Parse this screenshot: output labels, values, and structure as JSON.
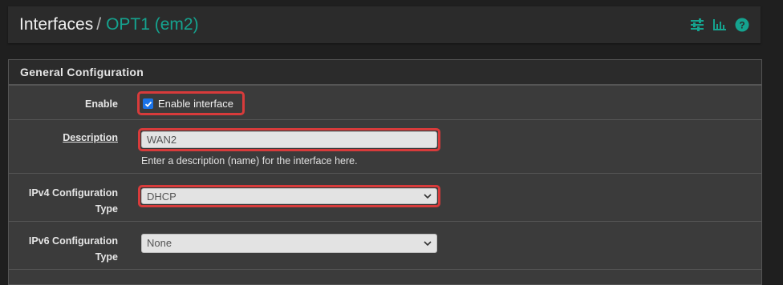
{
  "breadcrumb": {
    "section": "Interfaces",
    "separator": "/",
    "current": "OPT1 (em2)"
  },
  "header_icons": [
    "sliders-icon",
    "bar-chart-icon",
    "help-circle-icon"
  ],
  "panel": {
    "title": "General Configuration"
  },
  "form": {
    "enable": {
      "label": "Enable",
      "checkbox_label": "Enable interface",
      "checked": true
    },
    "description": {
      "label": "Description",
      "value": "WAN2",
      "help": "Enter a description (name) for the interface here."
    },
    "ipv4_type": {
      "label_line1": "IPv4 Configuration",
      "label_line2": "Type",
      "value": "DHCP"
    },
    "ipv6_type": {
      "label_line1": "IPv6 Configuration",
      "label_line2": "Type",
      "value": "None"
    }
  },
  "colors": {
    "accent": "#15a38f",
    "highlight": "#d83b3b",
    "checkbox": "#1a73e8"
  }
}
